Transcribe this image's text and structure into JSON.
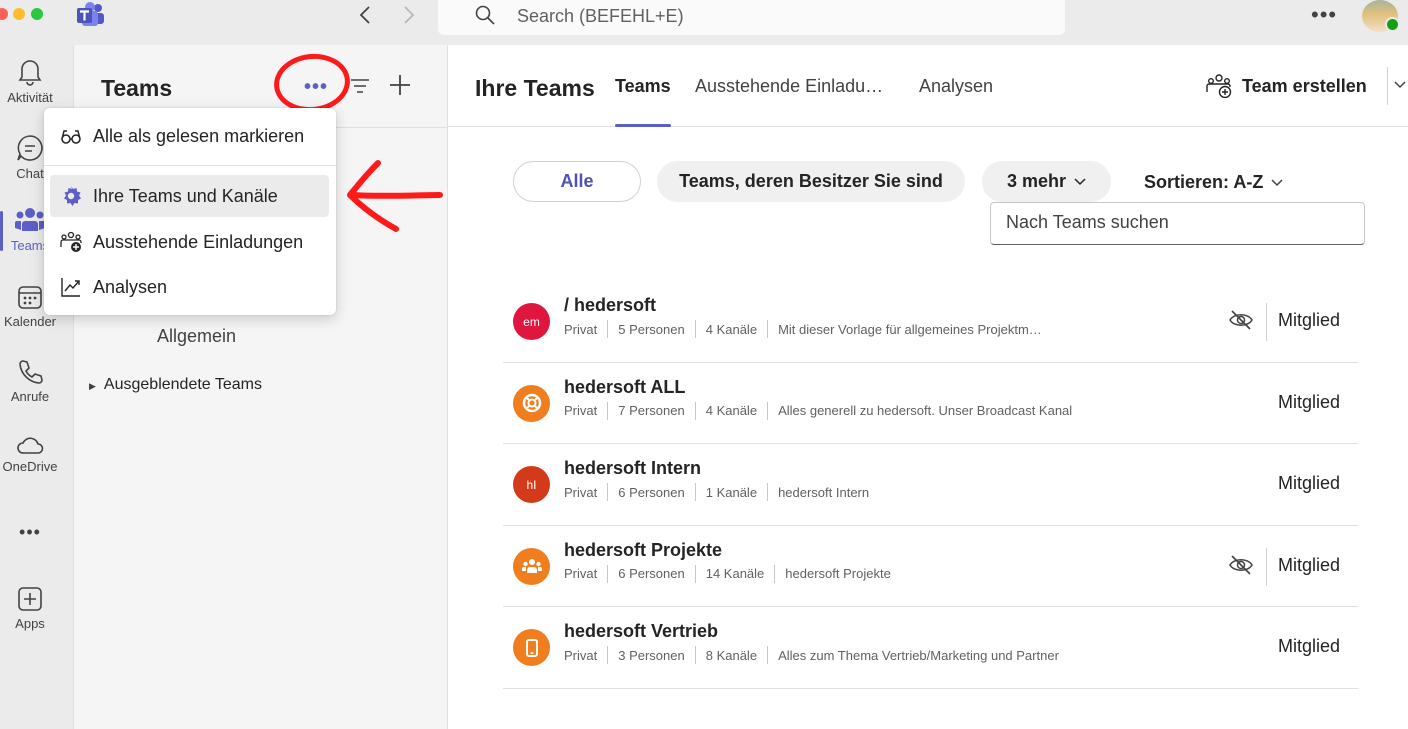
{
  "titlebar": {
    "search_placeholder": "Search (BEFEHL+E)"
  },
  "rail": {
    "items": [
      {
        "label": "Aktivität",
        "icon": "bell-icon"
      },
      {
        "label": "Chat",
        "icon": "chat-icon"
      },
      {
        "label": "Teams",
        "icon": "teams-icon",
        "active": true
      },
      {
        "label": "Kalender",
        "icon": "calendar-icon"
      },
      {
        "label": "Anrufe",
        "icon": "phone-icon"
      },
      {
        "label": "OneDrive",
        "icon": "cloud-icon"
      },
      {
        "label": "Apps",
        "icon": "add-apps-icon"
      }
    ],
    "more": "•••"
  },
  "sidepanel": {
    "title": "Teams",
    "more_label": "•••",
    "channel": "Allgemein",
    "hidden_teams": "Ausgeblendete Teams"
  },
  "menu": {
    "items": [
      {
        "label": "Alle als gelesen markieren",
        "icon": "glasses-icon"
      },
      {
        "label": "Ihre Teams und Kanäle",
        "icon": "gear-icon"
      },
      {
        "label": "Ausstehende Einladungen",
        "icon": "team-add-icon"
      },
      {
        "label": "Analysen",
        "icon": "chart-line-icon"
      }
    ]
  },
  "main": {
    "title": "Ihre Teams",
    "tabs": [
      {
        "label": "Teams",
        "active": true
      },
      {
        "label": "Ausstehende Einladu…"
      },
      {
        "label": "Analysen"
      }
    ],
    "create_team": "Team erstellen",
    "filters": {
      "all": "Alle",
      "owner": "Teams, deren Besitzer Sie sind",
      "more": "3 mehr",
      "sort": "Sortieren: A-Z"
    },
    "team_search_placeholder": "Nach Teams suchen",
    "teams": [
      {
        "name": "/ hedersoft",
        "initials": "em",
        "color": "#e0163e",
        "privacy": "Privat",
        "people": "5 Personen",
        "channels": "4 Kanäle",
        "description": "Mit dieser Vorlage für allgemeines Projektm…",
        "hidden": true,
        "role": "Mitglied"
      },
      {
        "name": "hedersoft ALL",
        "initials": "",
        "color": "#f07d1e",
        "icon": "lifebuoy-icon",
        "privacy": "Privat",
        "people": "7 Personen",
        "channels": "4 Kanäle",
        "description": "Alles generell zu hedersoft. Unser Broadcast Kanal",
        "hidden": false,
        "role": "Mitglied"
      },
      {
        "name": "hedersoft Intern",
        "initials": "hI",
        "color": "#d33a1a",
        "privacy": "Privat",
        "people": "6 Personen",
        "channels": "1 Kanäle",
        "description": "hedersoft Intern",
        "hidden": false,
        "role": "Mitglied"
      },
      {
        "name": "hedersoft Projekte",
        "initials": "",
        "color": "#f07d1e",
        "icon": "people-group-icon",
        "privacy": "Privat",
        "people": "6 Personen",
        "channels": "14 Kanäle",
        "description": "hedersoft Projekte",
        "hidden": true,
        "role": "Mitglied"
      },
      {
        "name": "hedersoft Vertrieb",
        "initials": "",
        "color": "#f07d1e",
        "icon": "mobile-phone-icon",
        "privacy": "Privat",
        "people": "3 Personen",
        "channels": "8 Kanäle",
        "description": "Alles zum Thema Vertrieb/Marketing und Partner",
        "hidden": false,
        "role": "Mitglied"
      }
    ]
  },
  "colors": {
    "accent": "#5b5fc7",
    "annotation": "#ff1a1a"
  }
}
